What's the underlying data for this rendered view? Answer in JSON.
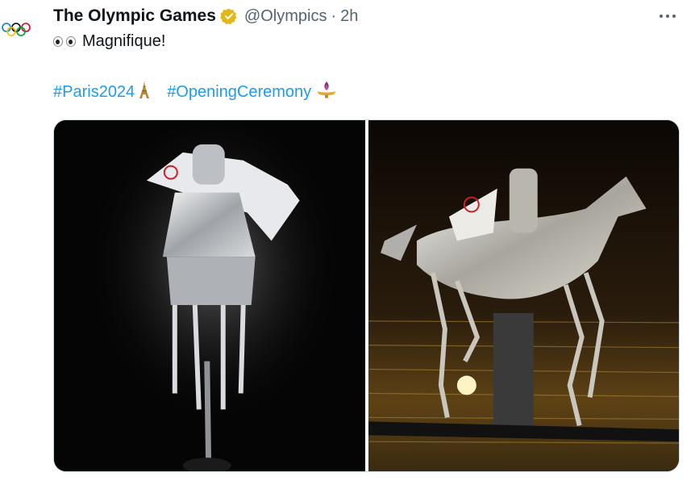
{
  "tweet": {
    "author_name": "The Olympic Games",
    "handle": "@Olympics",
    "separator": "·",
    "time": "2h",
    "text": "Magnifique!",
    "hashtags": [
      "#Paris2024",
      "#OpeningCeremony"
    ]
  },
  "icons": {
    "avatar": "olympic-rings-icon",
    "badge": "verified-gold-badge-icon",
    "more": "more-horizontal-icon",
    "text_emoji": "eyes-emoji-icon",
    "tag1_emoji": "eiffel-tower-emoji-icon",
    "tag2_emoji": "olympic-flame-emoji-icon"
  },
  "colors": {
    "hashtag": "#1d9bf0",
    "verified_gold": "#e2b719",
    "muted_text": "#536471",
    "rings": [
      "#0085c7",
      "#f4c300",
      "#000000",
      "#009f3d",
      "#df0024"
    ]
  },
  "media": [
    {
      "description_icon": "silver-horse-rider-front-photo"
    },
    {
      "description_icon": "silver-horse-rider-side-photo"
    }
  ]
}
